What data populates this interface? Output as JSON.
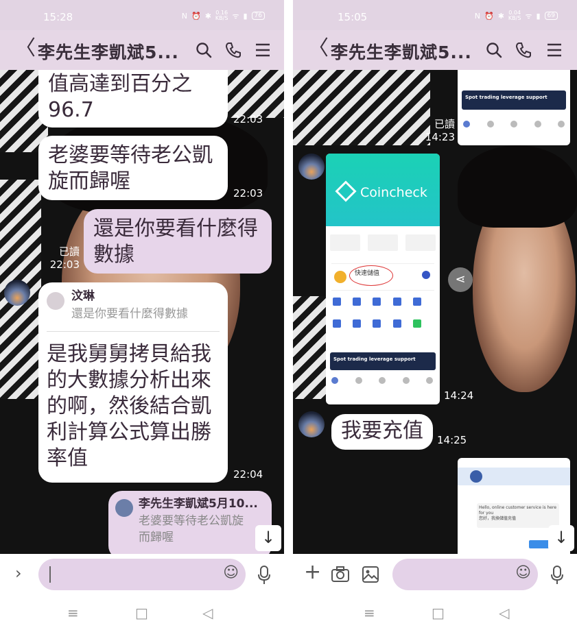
{
  "left": {
    "status_time": "15:28",
    "battery": "76",
    "net": "0.16",
    "net_unit": "KB/S",
    "chat_title": "李先生李凱斌5...",
    "messages": {
      "m1_line1": "值高達到百分之",
      "m1_line2": "96.7",
      "m1_time": "22:03",
      "m2_line1": "老婆要等待老公凱",
      "m2_line2": "旋而歸喔",
      "m2_time": "22:03",
      "m3_line1": "還是你要看什麼得",
      "m3_line2": "數據",
      "m3_read": "已讀",
      "m3_time": "22:03",
      "reply_name": "汶琳",
      "reply_quote": "還是你要看什麼得數據",
      "m4_line1": "是我舅舅拷貝給我",
      "m4_line2": "的大數據分析出來",
      "m4_line3": "的啊，然後結合凱",
      "m4_line4": "利計算公式算出勝",
      "m4_line5": "率值",
      "m4_time": "22:04",
      "quote_name": "李先生李凱斌5月10...",
      "quote_line1": "老婆要等待老公凱旋",
      "quote_line2": "而歸喔"
    }
  },
  "right": {
    "status_time": "15:05",
    "battery": "69",
    "net": "0.04",
    "net_unit": "KB/S",
    "chat_title": "李先生李凱斌5...",
    "messages": {
      "read": "已讀",
      "read_time": "14:23",
      "shot_time": "14:24",
      "m1": "我要充值",
      "m1_time": "14:25"
    },
    "coincheck": {
      "brand": "Coincheck",
      "banner": "Spot trading leverage support",
      "fast": "快速儲值",
      "service_greeting": "Hello, online customer service is here for you",
      "service_reply": "您好，我換儲值充值"
    }
  },
  "nav": {
    "menu": "≡",
    "home": "□",
    "back": "◁"
  },
  "colors": {
    "header": "#e6d7e6",
    "status": "#e2d4e3",
    "pink_bubble": "#e7d5ea",
    "input": "#e4d2e8"
  }
}
